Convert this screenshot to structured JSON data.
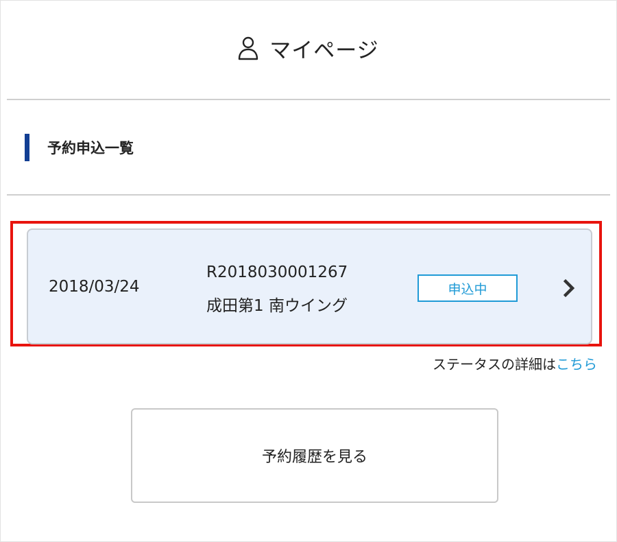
{
  "header": {
    "title": "マイページ",
    "icon": "user-icon"
  },
  "section": {
    "title": "予約申込一覧",
    "accent_color": "#123f93"
  },
  "booking": {
    "date": "2018/03/24",
    "number": "R2018030001267",
    "terminal": "成田第1 南ウイング",
    "status": "申込中",
    "status_color": "#1f9ad6",
    "card_color": "#eaf1fb",
    "highlight_color": "#e8140e"
  },
  "status_help": {
    "text": "ステータスの詳細は",
    "link_text": "こちら"
  },
  "history_button": {
    "label": "予約履歴を見る"
  }
}
